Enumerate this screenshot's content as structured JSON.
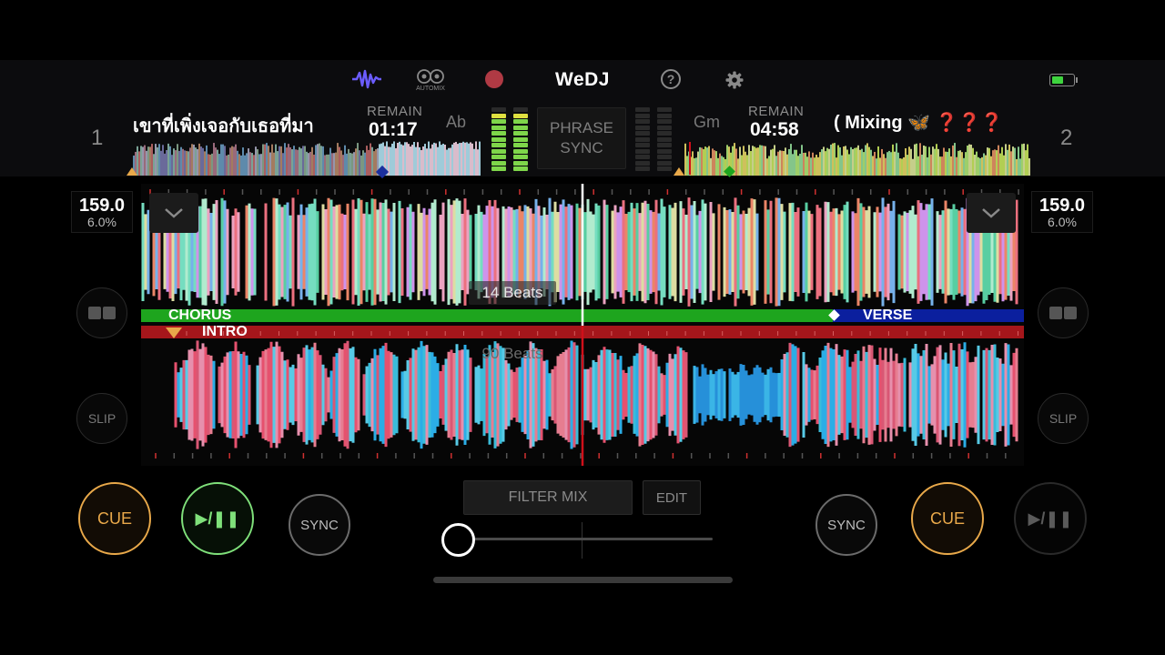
{
  "app": {
    "logo": "WeDJ",
    "automix_label": "AUTOMIX",
    "icons": [
      "waveform-icon",
      "automix-icon",
      "record-icon",
      "help-icon",
      "gear-icon",
      "battery-icon"
    ]
  },
  "deck1": {
    "number": "1",
    "title": "เขาที่เพิ่งเจอกับเธอที่มา",
    "remain_label": "REMAIN",
    "remain_time": "01:17",
    "key": "Ab",
    "bpm": "159.0",
    "pitch": "6.0%",
    "slip_label": "SLIP",
    "cue_label": "CUE",
    "play_label": "▶/❚❚",
    "sync_label": "SYNC",
    "beats_label": "90 Beats"
  },
  "deck2": {
    "number": "2",
    "title": "( Mixing 🦋 ❓❓❓",
    "remain_label": "REMAIN",
    "remain_time": "04:58",
    "key": "Gm",
    "bpm": "159.0",
    "pitch": "6.0%",
    "slip_label": "SLIP",
    "cue_label": "CUE",
    "play_label": "▶/❚❚",
    "sync_label": "SYNC",
    "beats_label": "14 Beats"
  },
  "phrase_sync": {
    "line1": "PHRASE",
    "line2": "SYNC"
  },
  "phrases": {
    "deck2_a": "CHORUS",
    "deck2_b": "VERSE",
    "deck1_a": "INTRO"
  },
  "mixer": {
    "filter_label": "FILTER MIX",
    "edit_label": "EDIT"
  },
  "colors": {
    "cue": "#e9a94a",
    "play_active": "#7fe07a",
    "chorus": "#1ea51e",
    "verse": "#0b1f9e",
    "intro": "#a5161b",
    "playhead_deck2": "#ffffff",
    "playhead_deck1": "#d0101a"
  }
}
